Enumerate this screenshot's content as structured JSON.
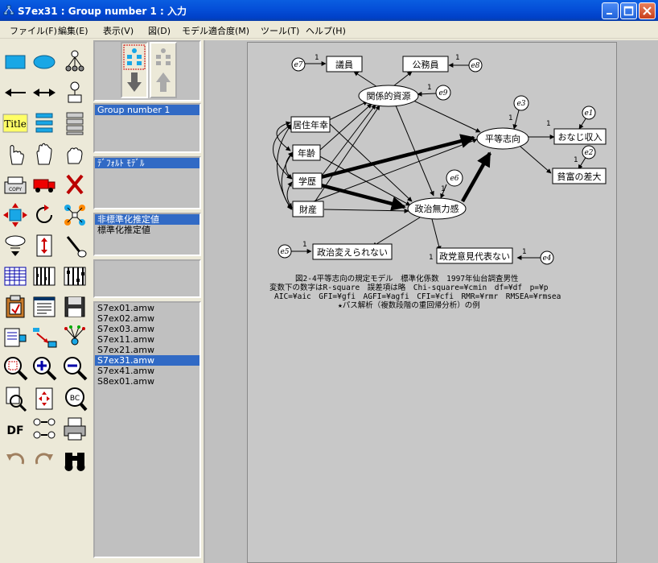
{
  "window": {
    "title": "S7ex31 : Group number 1 : 入力"
  },
  "menu": [
    "ファイル(F)",
    "編集(E)",
    "表示(V)",
    "図(D)",
    "モデル適合度(M)",
    "ツール(T)",
    "ヘルプ(H)"
  ],
  "panels": {
    "groups": [
      "Group number 1"
    ],
    "models": [
      "ﾃﾞﾌｫﾙﾄ ﾓﾃﾞﾙ"
    ],
    "estimates": [
      "非標準化推定値",
      "標準化推定値"
    ],
    "files": [
      "S7ex01.amw",
      "S7ex02.amw",
      "S7ex03.amw",
      "S7ex11.amw",
      "S7ex21.amw",
      "S7ex31.amw",
      "S7ex41.amw",
      "S8ex01.amw"
    ],
    "selected_file": "S7ex31.amw"
  },
  "palette": {
    "title_label": "Title",
    "df_label": "DF"
  },
  "diagram": {
    "observed": [
      "議員",
      "公務員",
      "居住年幸",
      "年齢",
      "学歴",
      "財産",
      "おなじ収入",
      "貧富の差大",
      "政治変えられない",
      "政党意見代表ない"
    ],
    "latent": [
      "関係的資源",
      "平等志向",
      "政治無力感"
    ],
    "errors": [
      "e7",
      "e8",
      "e9",
      "e3",
      "e1",
      "e2",
      "e6",
      "e5",
      "e4"
    ],
    "path_label": "1"
  },
  "caption": {
    "line1": "図2-4平等志向の規定モデル　標準化係数　1997年仙台調査男性",
    "line2": "変数下の数字はR-square　誤差項は略　Chi-square=¥cmin　df=¥df　p=¥p",
    "line3": "AIC=¥aic　GFI=¥gfi　AGFI=¥agfi　CFI=¥cfi　RMR=¥rmr　RMSEA=¥rmsea",
    "line4": "★パス解析（複数段階の重回帰分析）の例"
  }
}
